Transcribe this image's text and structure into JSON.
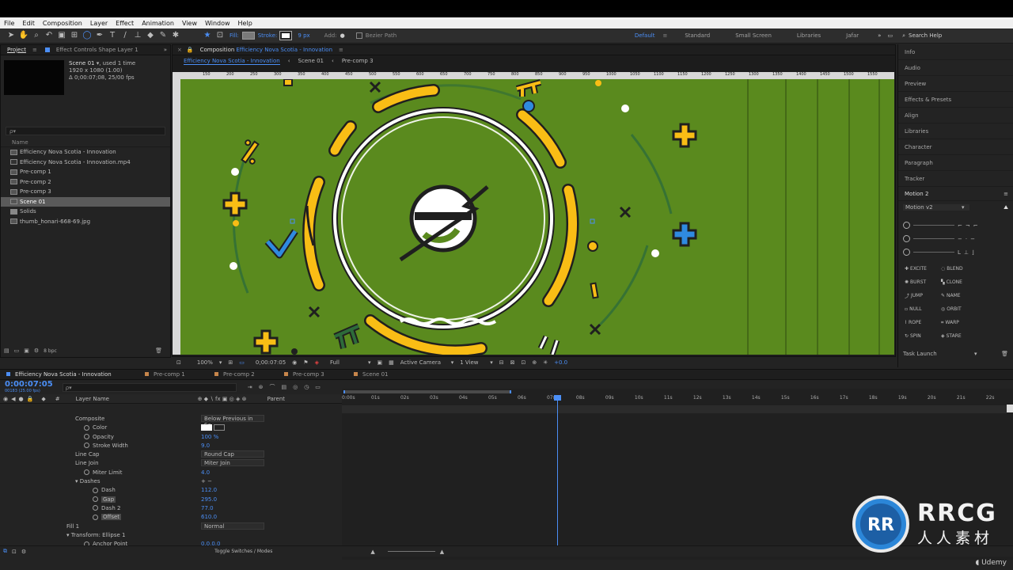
{
  "menu": [
    "File",
    "Edit",
    "Composition",
    "Layer",
    "Effect",
    "Animation",
    "View",
    "Window",
    "Help"
  ],
  "toolbar": {
    "fill_label": "Fill:",
    "stroke_label": "Stroke:",
    "stroke_width": "9 px",
    "add_label": "Add:",
    "bezier_label": "Bezier Path",
    "workspaces": [
      "Default",
      "Standard",
      "Small Screen",
      "Libraries",
      "Jafar"
    ],
    "search_placeholder": "Search Help"
  },
  "project": {
    "tab_project": "Project",
    "tab_effects": "Effect Controls Shape Layer 1",
    "item_name": "Scene 01",
    "item_used": ", used 1 time",
    "item_res": "1920 x 1080 (1.00)",
    "item_dur": "Δ 0;00:07;08, 25/00 fps",
    "search_placeholder": "ρ▾",
    "col_name": "Name",
    "bpc": "8 bpc",
    "items": [
      {
        "name": "Efficiency Nova Scotia - Innovation",
        "type": "comp"
      },
      {
        "name": "Efficiency Nova Scotia - Innovation.mp4",
        "type": "video"
      },
      {
        "name": "Pre-comp 1",
        "type": "comp"
      },
      {
        "name": "Pre-comp 2",
        "type": "comp"
      },
      {
        "name": "Pre-comp 3",
        "type": "comp"
      },
      {
        "name": "Scene 01",
        "type": "comp",
        "selected": true
      },
      {
        "name": "Solids",
        "type": "folder"
      },
      {
        "name": "thumb_honari-668-69.jpg",
        "type": "image"
      }
    ]
  },
  "composition": {
    "tab_label": "Composition",
    "tab_name": "Efficiency Nova Scotia - Innovation",
    "crumbs": [
      "Efficiency Nova Scotia - Innovation",
      "Scene 01",
      "Pre-comp 3"
    ],
    "ruler_ticks": [
      "150",
      "200",
      "250",
      "300",
      "350",
      "400",
      "450",
      "500",
      "550",
      "600",
      "650",
      "700",
      "750",
      "800",
      "850",
      "900",
      "950",
      "1000",
      "1050",
      "1100",
      "1150",
      "1200",
      "1250",
      "1300",
      "1350",
      "1400",
      "1450",
      "1500",
      "1550",
      "1600"
    ],
    "zoom": "100%",
    "timecode": "0;00:07:05",
    "resolution": "Full",
    "camera": "Active Camera",
    "views": "1 View",
    "exposure": "+0.0"
  },
  "right_panel": {
    "items": [
      "Info",
      "Audio",
      "Preview",
      "Effects & Presets",
      "Align",
      "Libraries",
      "Character",
      "Paragraph",
      "Tracker"
    ],
    "motion_title": "Motion 2",
    "motion_version": "Motion v2",
    "motion_buttons": [
      "EXCITE",
      "BLEND",
      "BURST",
      "CLONE",
      "JUMP",
      "NAME",
      "NULL",
      "ORBIT",
      "ROPE",
      "WARP",
      "SPIN",
      "STARE"
    ],
    "task_launch": "Task Launch"
  },
  "timeline": {
    "tabs": [
      "Efficiency Nova Scotia - Innovation",
      "Pre-comp 1",
      "Pre-comp 2",
      "Pre-comp 3",
      "Scene 01"
    ],
    "timecode": "0:00:07:05",
    "timecode_sub": "00183 (25.00 fps)",
    "col_layer": "Layer Name",
    "col_parent": "Parent",
    "toggle_label": "Toggle Switches / Modes",
    "time_ticks": [
      "0:00s",
      "01s",
      "02s",
      "03s",
      "04s",
      "05s",
      "06s",
      "07s",
      "08s",
      "09s",
      "10s",
      "11s",
      "12s",
      "13s",
      "14s",
      "15s",
      "16s",
      "17s",
      "18s",
      "19s",
      "20s",
      "21s",
      "22s"
    ],
    "playhead_fraction": 0.325,
    "props": [
      {
        "label": "Composite",
        "value": "Below Previous in Sa",
        "indent": 1,
        "kind": "dropdown"
      },
      {
        "label": "Color",
        "value": "",
        "indent": 2,
        "kind": "color"
      },
      {
        "label": "Opacity",
        "value": "100 %",
        "indent": 2,
        "kind": "value"
      },
      {
        "label": "Stroke Width",
        "value": "9.0",
        "indent": 2,
        "kind": "value"
      },
      {
        "label": "Line Cap",
        "value": "Round Cap",
        "indent": 1,
        "kind": "dropdown"
      },
      {
        "label": "Line Join",
        "value": "Miter Join",
        "indent": 1,
        "kind": "dropdown"
      },
      {
        "label": "Miter Limit",
        "value": "4.0",
        "indent": 2,
        "kind": "value"
      },
      {
        "label": "Dashes",
        "value": "+ −",
        "indent": 1,
        "kind": "group"
      },
      {
        "label": "Dash",
        "value": "112.0",
        "indent": 3,
        "kind": "value"
      },
      {
        "label": "Gap",
        "value": "295.0",
        "indent": 3,
        "kind": "value",
        "highlight": true
      },
      {
        "label": "Dash 2",
        "value": "77.0",
        "indent": 3,
        "kind": "value"
      },
      {
        "label": "Offset",
        "value": "610.0",
        "indent": 3,
        "kind": "value",
        "highlight": true
      },
      {
        "label": "Fill 1",
        "value": "Normal",
        "indent": 0,
        "kind": "dropdown"
      },
      {
        "label": "Transform: Ellipse 1",
        "value": "",
        "indent": 0,
        "kind": "group"
      },
      {
        "label": "Anchor Point",
        "value": "0.0,0.0",
        "indent": 2,
        "kind": "value"
      }
    ]
  },
  "watermark": {
    "brand": "RRCG",
    "brand_sub": "人人素材",
    "udemy": "Udemy"
  },
  "colors": {
    "accent": "#4b8ef5",
    "canvas_bg": "#5a8a1e",
    "yellow": "#f9bd15",
    "blue_shape": "#2f8ae0"
  }
}
